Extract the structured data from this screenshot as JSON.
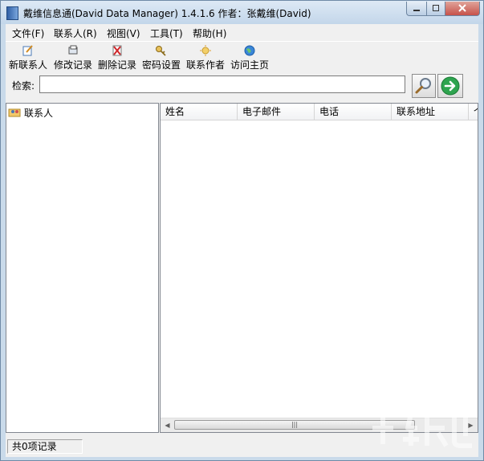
{
  "window": {
    "title": "戴维信息通(David Data Manager) 1.4.1.6   作者：张戴维(David)"
  },
  "menu": [
    {
      "label": "文件(F)"
    },
    {
      "label": "联系人(R)"
    },
    {
      "label": "视图(V)"
    },
    {
      "label": "工具(T)"
    },
    {
      "label": "帮助(H)"
    }
  ],
  "toolbar": [
    {
      "label": "新联系人",
      "icon": "new-contact-icon"
    },
    {
      "label": "修改记录",
      "icon": "edit-record-icon"
    },
    {
      "label": "删除记录",
      "icon": "delete-record-icon"
    },
    {
      "label": "密码设置",
      "icon": "key-icon"
    },
    {
      "label": "联系作者",
      "icon": "contact-author-icon"
    },
    {
      "label": "访问主页",
      "icon": "globe-icon"
    }
  ],
  "search": {
    "label": "检索:",
    "value": ""
  },
  "tree": {
    "root_label": "联系人"
  },
  "list": {
    "columns": [
      "姓名",
      "电子邮件",
      "电话",
      "联系地址",
      "个"
    ]
  },
  "status": {
    "text": "共0项记录"
  },
  "colors": {
    "title_bar": "#c9daea",
    "close_button": "#c7524a",
    "go_button": "#2ea44f"
  }
}
